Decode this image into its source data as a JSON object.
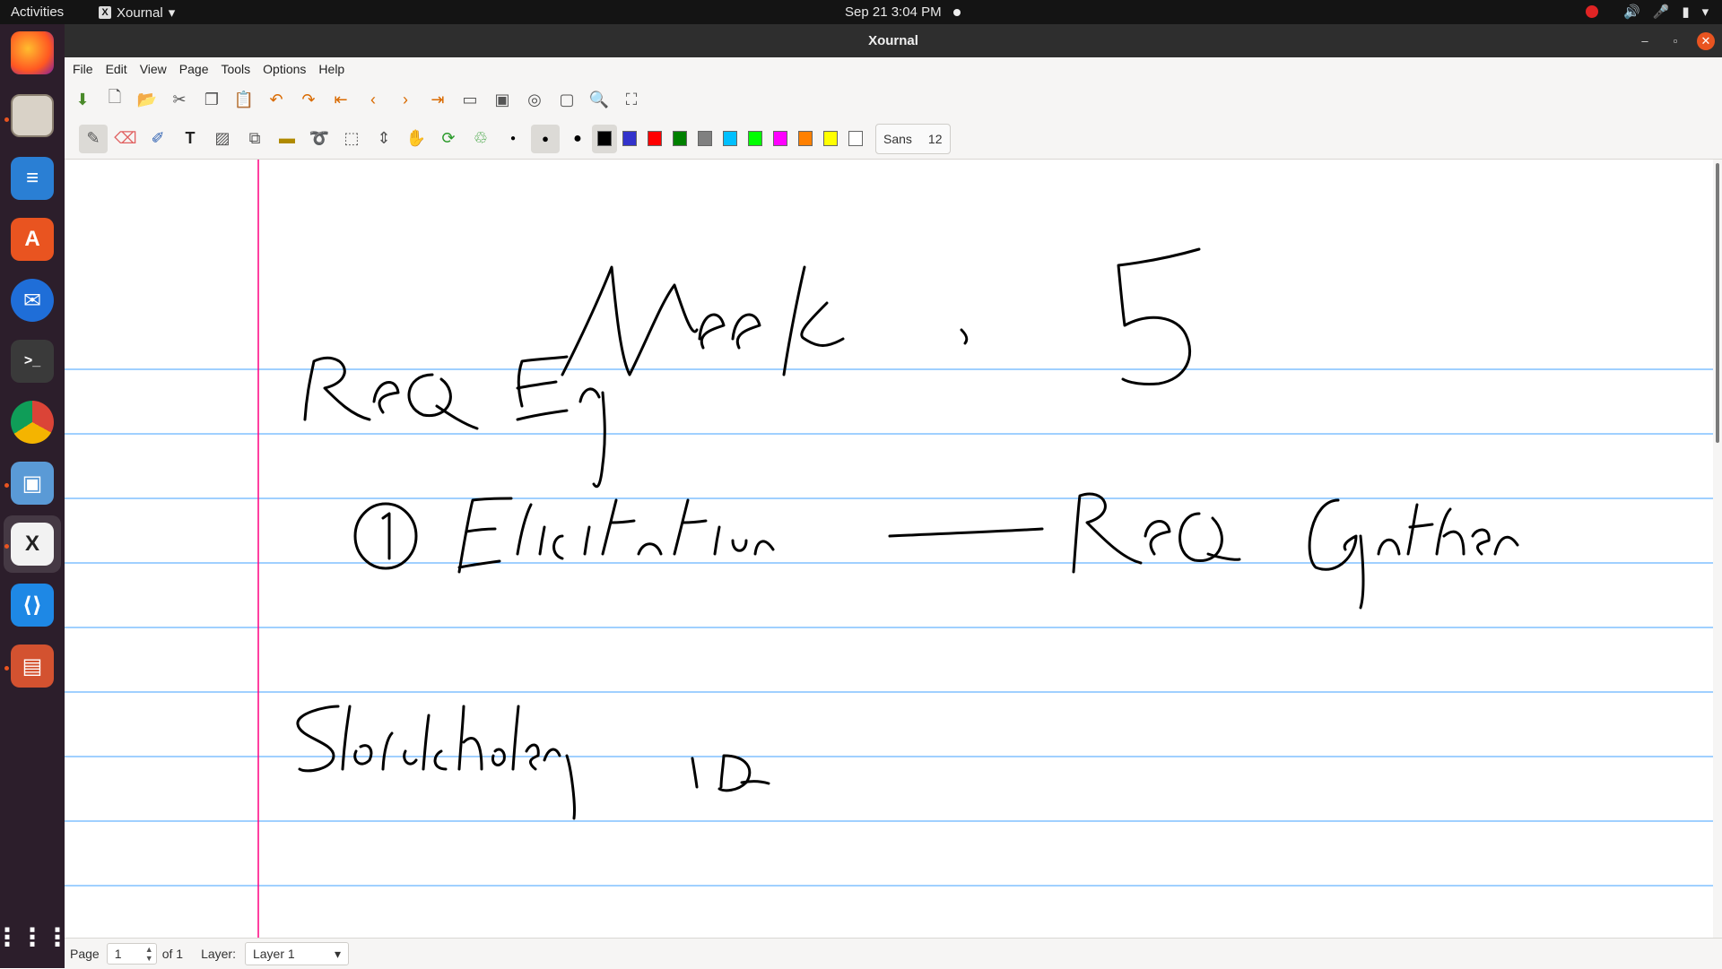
{
  "topbar": {
    "activities": "Activities",
    "app_name": "Xournal",
    "clock": "Sep 21  3:04 PM"
  },
  "window": {
    "title": "Xournal",
    "minimize": "–",
    "maximize": "▫",
    "close": "✕"
  },
  "menu": [
    "File",
    "Edit",
    "View",
    "Page",
    "Tools",
    "Options",
    "Help"
  ],
  "toolbar1_icons": [
    "save-icon",
    "new-page-icon",
    "open-icon",
    "cut-icon",
    "copy-icon",
    "paste-icon",
    "undo-icon",
    "redo-icon",
    "first-page-icon",
    "previous-page-icon",
    "next-page-icon",
    "last-page-icon",
    "zoom-out-icon",
    "zoom-fit-icon",
    "zoom-in-icon",
    "normal-size-icon",
    "find-icon",
    "fullscreen-icon"
  ],
  "toolbar2_tools": [
    "pen-icon",
    "eraser-icon",
    "highlighter-icon",
    "text-icon",
    "image-icon",
    "shape-icon",
    "ruler-icon",
    "lasso-icon",
    "rect-select-icon",
    "vertical-space-icon",
    "hand-icon",
    "default-tools-icon",
    "shape-recognizer-icon"
  ],
  "colors": [
    "#000000",
    "#3333cc",
    "#ff0000",
    "#008000",
    "#808080",
    "#00c0ff",
    "#00ff00",
    "#ff00ff",
    "#ff8000",
    "#ffff00",
    "#ffffff"
  ],
  "font": {
    "name": "Sans",
    "size": "12"
  },
  "page_style": {
    "rule_color": "#40a0ff",
    "margin_color": "#ff0080"
  },
  "statusbar": {
    "page_label": "Page",
    "page_value": "1",
    "of_label": "of 1",
    "layer_label": "Layer:",
    "layer_value": "Layer 1"
  }
}
